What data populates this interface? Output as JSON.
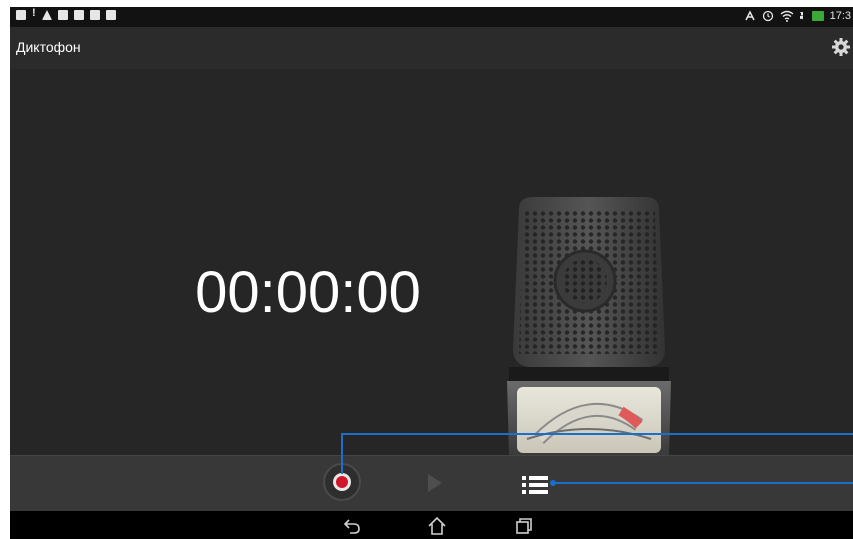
{
  "status_bar": {
    "time": "17:3",
    "left_icons": [
      "screenshot-icon",
      "alert-icon",
      "warning-icon",
      "sd-card-icon",
      "file-icon",
      "image-icon",
      "video-icon"
    ],
    "right_icons": [
      "nfc-icon",
      "alarm-icon",
      "wifi-icon",
      "battery-charging-icon"
    ]
  },
  "action_bar": {
    "title": "Диктофон",
    "settings_icon": "gear-icon"
  },
  "main": {
    "timer": "00:00:00",
    "illustration": "microphone-vu-meter"
  },
  "controls": {
    "record_icon": "record-icon",
    "play_icon": "play-icon",
    "list_icon": "recordings-list-icon",
    "record_color": "#d0162b"
  },
  "nav_bar": {
    "icons": [
      "back-icon",
      "home-icon",
      "recents-icon"
    ]
  },
  "callout_color": "#1c6ecb"
}
